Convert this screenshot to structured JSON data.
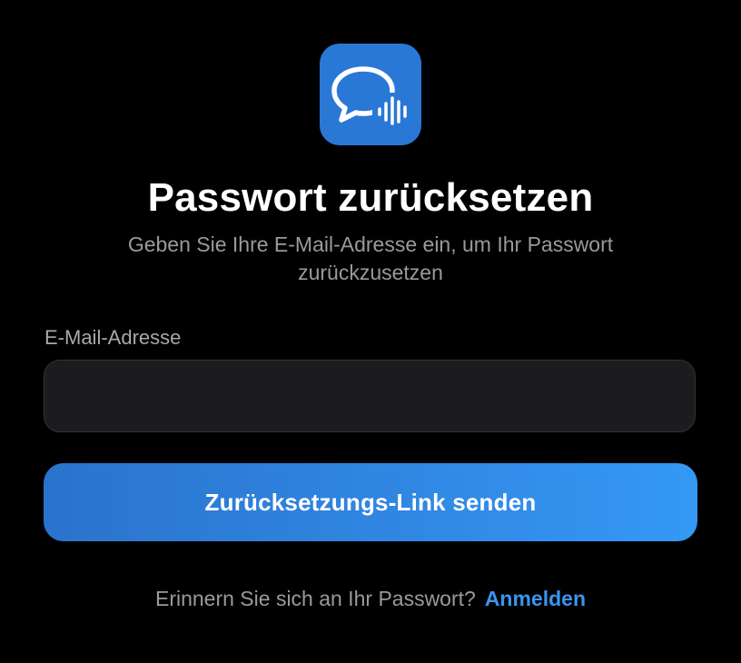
{
  "app": {
    "icon": "chat-bubble-soundwave-icon",
    "icon_color": "#2a78d6"
  },
  "header": {
    "title": "Passwort zurücksetzen",
    "subtitle": "Geben Sie Ihre E-Mail-Adresse ein, um Ihr Passwort zurückzusetzen"
  },
  "form": {
    "email_label": "E-Mail-Adresse",
    "email_value": "",
    "email_placeholder": "",
    "submit_label": "Zurücksetzungs-Link senden"
  },
  "footer": {
    "prompt": "Erinnern Sie sich an Ihr Passwort?",
    "link_label": "Anmelden"
  },
  "colors": {
    "background": "#000000",
    "accent": "#3a95f0",
    "button_gradient_start": "#2a73cc",
    "button_gradient_end": "#3598f5",
    "input_background": "#1c1c1e",
    "muted_text": "#9a9a9e"
  }
}
